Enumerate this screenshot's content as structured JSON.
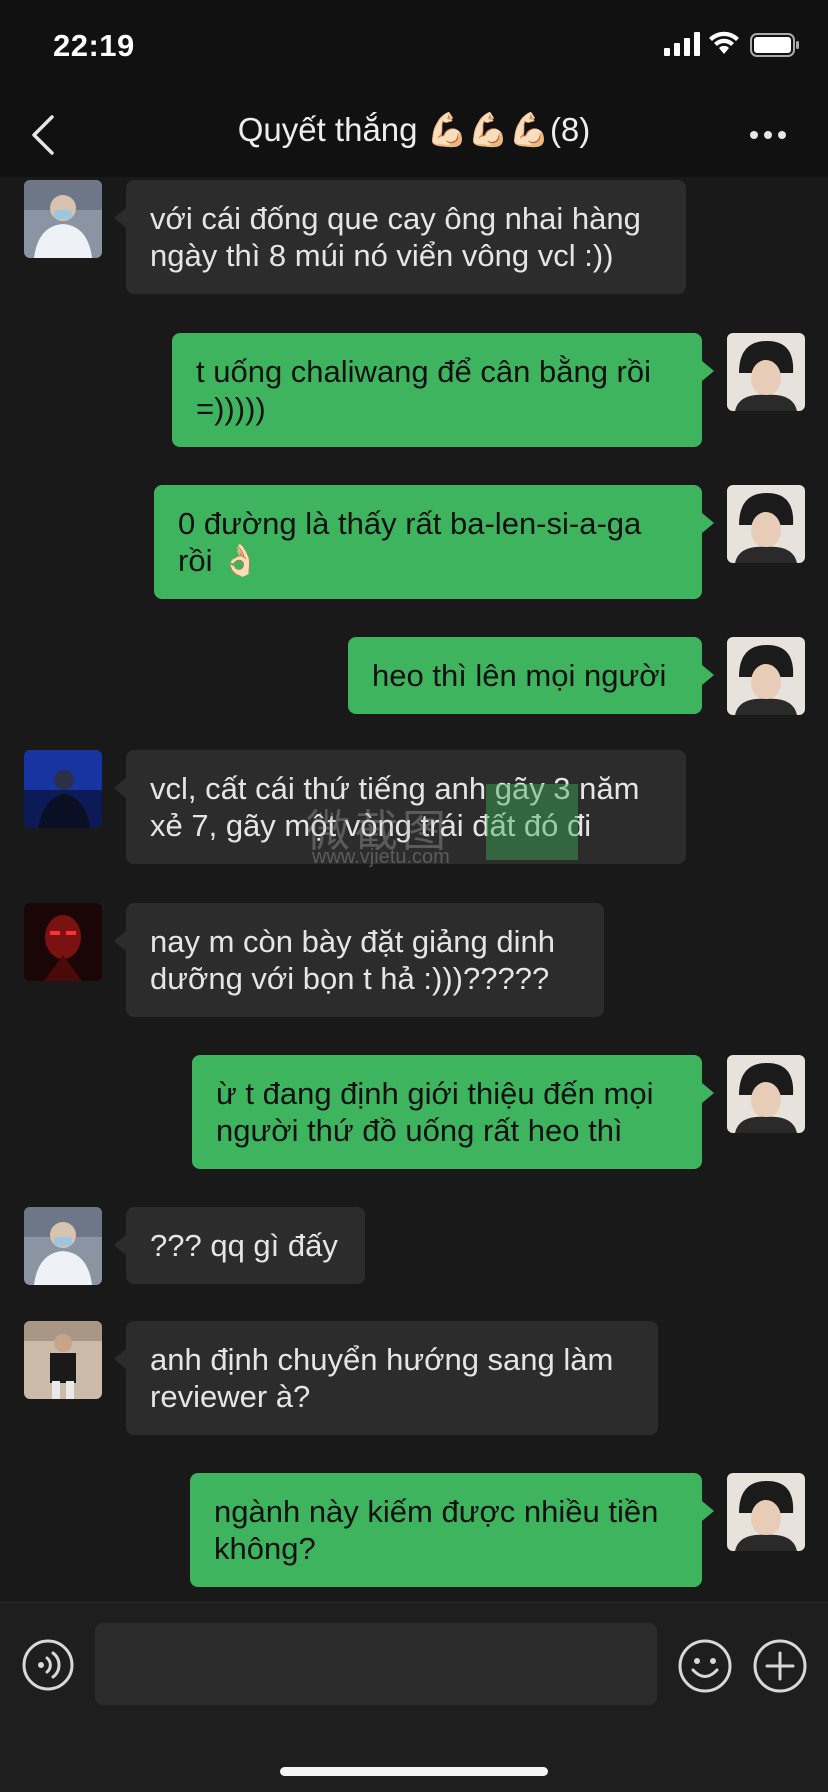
{
  "status_bar": {
    "time": "22:19"
  },
  "nav": {
    "title": "Quyết thắng 💪🏻💪🏻💪🏻(8)"
  },
  "messages": [
    {
      "text": "với cái đống que cay ông nhai hàng ngày thì 8 múi nó viển vông vcl :))"
    },
    {
      "text": "t uống chaliwang để cân bằng rồi =)))))"
    },
    {
      "text": "0 đường là thấy rất ba-len-si-a-ga rồi 👌🏻"
    },
    {
      "text": "heo thì lên mọi người"
    },
    {
      "text": "vcl, cất cái thứ tiếng anh gãy 3 năm xẻ 7,  gãy một vòng trái đất đó đi"
    },
    {
      "text": "nay m còn bày đặt giảng dinh dưỡng với bọn t hả :)))?????"
    },
    {
      "text": "ừ t đang định giới thiệu đến mọi người thứ đồ uống rất heo thì"
    },
    {
      "text": "??? qq gì đấy"
    },
    {
      "text": "anh định chuyển hướng sang làm reviewer à?"
    },
    {
      "text": "ngành này kiếm được nhiều tiền không?"
    }
  ],
  "watermark": {
    "text": "微截图",
    "url": "www.vjietu.com"
  },
  "input": {
    "value": ""
  },
  "colors": {
    "outgoing_bubble": "#3eb45f",
    "incoming_bubble": "#2c2c2c",
    "background": "#191919"
  }
}
